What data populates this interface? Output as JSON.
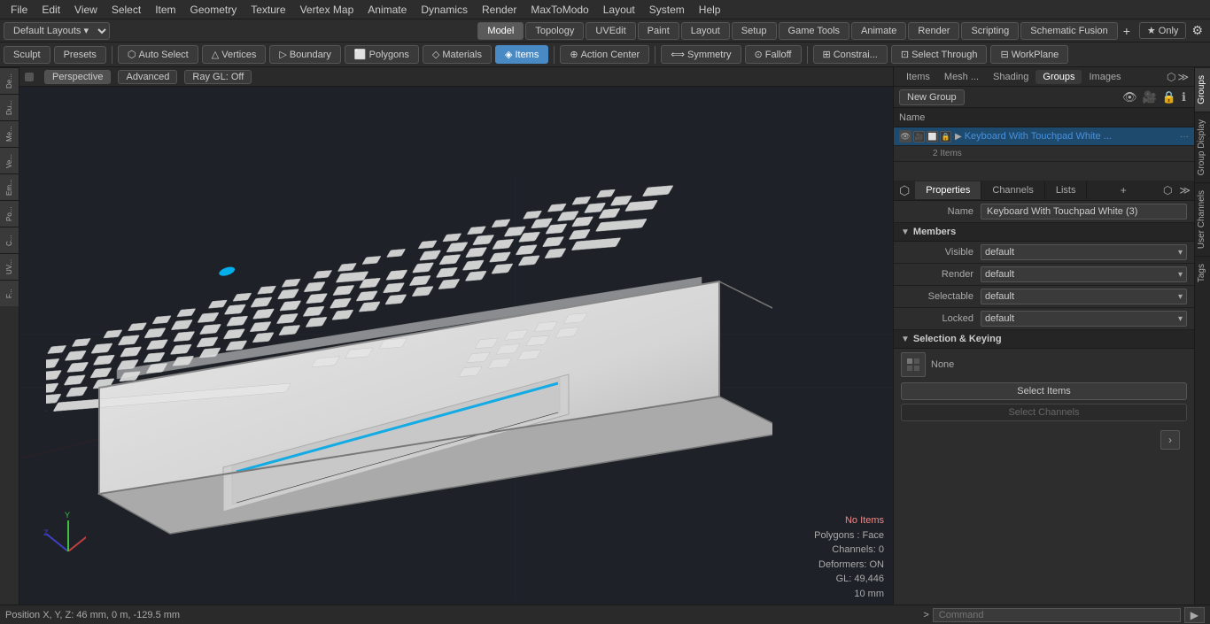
{
  "menuBar": {
    "items": [
      "File",
      "Edit",
      "View",
      "Select",
      "Item",
      "Geometry",
      "Texture",
      "Vertex Map",
      "Animate",
      "Dynamics",
      "Render",
      "MaxToModo",
      "Layout",
      "System",
      "Help"
    ]
  },
  "toolbar1": {
    "layout_label": "Default Layouts",
    "tabs": [
      "Model",
      "Topology",
      "UVEdit",
      "Paint",
      "Layout",
      "Setup",
      "Game Tools",
      "Animate",
      "Render",
      "Scripting",
      "Schematic Fusion"
    ],
    "active_tab": "Model",
    "star_label": "★ Only",
    "plus_label": "+"
  },
  "toolbar2": {
    "sculpt_label": "Sculpt",
    "presets_label": "Presets",
    "tools": [
      {
        "id": "auto-select",
        "label": "Auto Select",
        "active": false,
        "icon": "⬡"
      },
      {
        "id": "vertices",
        "label": "Vertices",
        "active": false,
        "icon": "△"
      },
      {
        "id": "boundary",
        "label": "Boundary",
        "active": false,
        "icon": "▷"
      },
      {
        "id": "polygons",
        "label": "Polygons",
        "active": false,
        "icon": "⬜"
      },
      {
        "id": "materials",
        "label": "Materials",
        "active": false,
        "icon": "◇"
      },
      {
        "id": "items",
        "label": "Items",
        "active": true,
        "icon": "◈"
      },
      {
        "id": "action-center",
        "label": "Action Center",
        "active": false,
        "icon": "⊕"
      },
      {
        "id": "symmetry",
        "label": "Symmetry",
        "active": false,
        "icon": "⟺"
      },
      {
        "id": "falloff",
        "label": "Falloff",
        "active": false,
        "icon": "⊙"
      },
      {
        "id": "constraints",
        "label": "Constrai...",
        "active": false,
        "icon": "⊞"
      },
      {
        "id": "select-through",
        "label": "Select Through",
        "active": false,
        "icon": "⊡"
      },
      {
        "id": "workplane",
        "label": "WorkPlane",
        "active": false,
        "icon": "⊟"
      }
    ]
  },
  "viewport": {
    "tabs": [
      "Perspective",
      "Advanced",
      "Ray GL: Off"
    ],
    "active_tab": "Perspective",
    "status": {
      "no_items": "No Items",
      "polygons": "Polygons : Face",
      "channels": "Channels: 0",
      "deformers": "Deformers: ON",
      "gl": "GL: 49,446",
      "mm": "10 mm"
    }
  },
  "rightPanel": {
    "tabs": [
      "Items",
      "Mesh ...",
      "Shading",
      "Groups",
      "Images"
    ],
    "active_tab": "Groups",
    "new_group_label": "New Group",
    "group_col_header": "Name",
    "groups": [
      {
        "name": "Keyboard With Touchpad White ...",
        "sub": "2 Items",
        "selected": true
      }
    ]
  },
  "properties": {
    "tabs": [
      "Properties",
      "Channels",
      "Lists"
    ],
    "active_tab": "Properties",
    "name_label": "Name",
    "name_value": "Keyboard With Touchpad White (3)",
    "members_label": "Members",
    "fields": [
      {
        "label": "Visible",
        "value": "default"
      },
      {
        "label": "Render",
        "value": "default"
      },
      {
        "label": "Selectable",
        "value": "default"
      },
      {
        "label": "Locked",
        "value": "default"
      }
    ],
    "selection_keying": {
      "label": "Selection & Keying",
      "keying_value": "None",
      "select_items_label": "Select Items",
      "select_channels_label": "Select Channels"
    }
  },
  "rightVTabs": [
    "Groups",
    "Group Display",
    "User Channels",
    "Tags"
  ],
  "bottomBar": {
    "position_label": "Position X, Y, Z:",
    "position_value": "46 mm, 0 m, -129.5 mm",
    "command_prefix": ">",
    "command_placeholder": "Command"
  },
  "leftSidebar": {
    "tabs": [
      "De...",
      "Du...",
      "Me...",
      "Ve...",
      "Em...",
      "Po...",
      "C...",
      "UV...",
      "F..."
    ]
  }
}
